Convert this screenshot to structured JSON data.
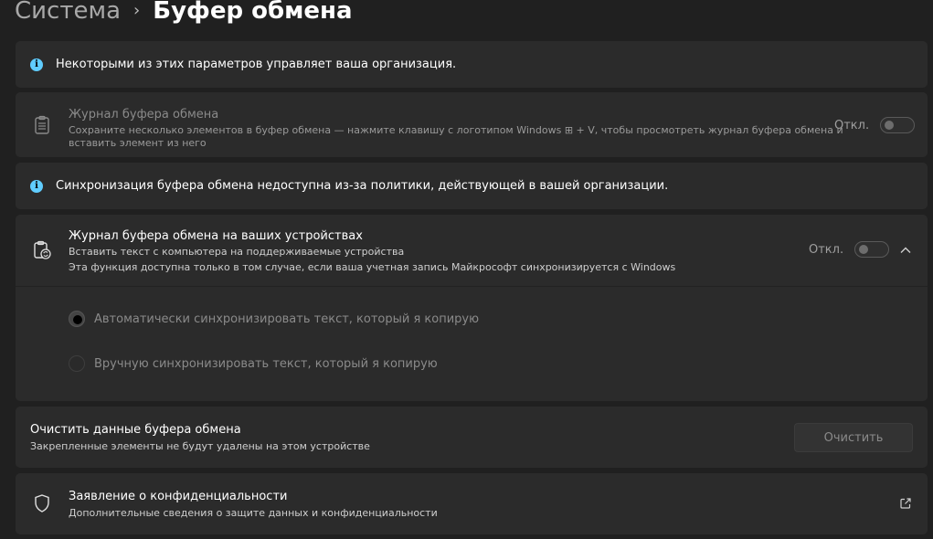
{
  "breadcrumb": {
    "parent": "Система",
    "separator": "›",
    "current": "Буфер обмена"
  },
  "info1": {
    "text": "Некоторыми из этих параметров управляет ваша организация."
  },
  "history": {
    "title": "Журнал буфера обмена",
    "desc_line1": "Сохраните несколько элементов в буфер обмена — нажмите клавишу с логотипом Windows ⊞ + V, чтобы просмотреть журнал буфера обмена и",
    "desc_line2": "вставить элемент из него",
    "toggle_label": "Откл.",
    "toggle_on": false
  },
  "info2": {
    "text": "Синхронизация буфера обмена недоступна из-за политики, действующей в вашей организации."
  },
  "sync": {
    "title": "Журнал буфера обмена на ваших устройствах",
    "desc_line1": "Вставить текст с компьютера на поддерживаемые устройства",
    "desc_line2": "Эта функция доступна только в том случае, если ваша учетная запись Майкрософт синхронизируется с Windows",
    "toggle_label": "Откл.",
    "toggle_on": false,
    "expanded": true,
    "options": [
      {
        "label": "Автоматически синхронизировать текст, который я копирую",
        "selected": true
      },
      {
        "label": "Вручную синхронизировать текст, который я копирую",
        "selected": false
      }
    ]
  },
  "clear": {
    "title": "Очистить данные буфера обмена",
    "desc": "Закрепленные элементы не будут удалены на этом устройстве",
    "button_label": "Очистить"
  },
  "privacy": {
    "title": "Заявление о конфиденциальности",
    "desc": "Дополнительные сведения о защите данных и конфиденциальности"
  },
  "colors": {
    "background": "#202020",
    "card": "#2b2b2b",
    "accent_info": "#60cdff"
  },
  "icons": {
    "info": "info-icon",
    "history": "clipboard-list-icon",
    "sync": "clipboard-sync-icon",
    "chevron": "chevron-up-icon",
    "privacy": "shield-icon",
    "external": "external-link-icon"
  }
}
